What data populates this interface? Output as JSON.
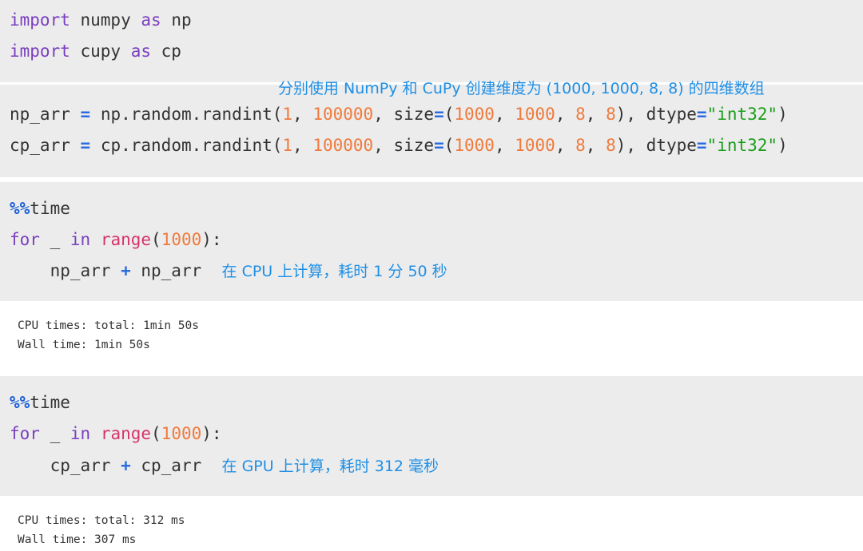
{
  "cells": [
    {
      "id": "imports",
      "lines": [
        {
          "kw1": "import",
          "mod": " numpy ",
          "kw2": "as",
          "alias": " np"
        },
        {
          "kw1": "import",
          "mod": " cupy ",
          "kw2": "as",
          "alias": " cp"
        }
      ]
    },
    {
      "id": "create-arrays",
      "annotation": "分别使用 NumPy 和 CuPy 创建维度为 (1000, 1000, 8, 8) 的四维数组",
      "lines": [
        {
          "var": "np_arr",
          "eq": "=",
          "call": " np.random.randint(",
          "a1": "1",
          "sep1": ", ",
          "a2": "100000",
          "sep2": ", size",
          "eq2": "=",
          "open": "(",
          "d1": "1000",
          "s1": ", ",
          "d2": "1000",
          "s2": ", ",
          "d3": "8",
          "s3": ", ",
          "d4": "8",
          "close": "), dtype",
          "eq3": "=",
          "dtype": "\"int32\"",
          "end": ")"
        },
        {
          "var": "cp_arr",
          "eq": "=",
          "call": " cp.random.randint(",
          "a1": "1",
          "sep1": ", ",
          "a2": "100000",
          "sep2": ", size",
          "eq2": "=",
          "open": "(",
          "d1": "1000",
          "s1": ", ",
          "d2": "1000",
          "s2": ", ",
          "d3": "8",
          "s3": ", ",
          "d4": "8",
          "close": "), dtype",
          "eq3": "=",
          "dtype": "\"int32\"",
          "end": ")"
        }
      ]
    },
    {
      "id": "numpy-timing",
      "magic": "%%",
      "magic_name": "time",
      "for_kw": "for",
      "loop_var": " _ ",
      "in_kw": "in",
      "range_fn": "range",
      "range_open": "(",
      "range_arg": "1000",
      "range_close": "):",
      "body_lhs": "    np_arr ",
      "body_op": "+",
      "body_rhs": " np_arr",
      "annotation": "在 CPU 上计算，耗时 1 分 50 秒",
      "output": [
        "CPU times: total: 1min 50s",
        "Wall time: 1min 50s"
      ]
    },
    {
      "id": "cupy-timing",
      "magic": "%%",
      "magic_name": "time",
      "for_kw": "for",
      "loop_var": " _ ",
      "in_kw": "in",
      "range_fn": "range",
      "range_open": "(",
      "range_arg": "1000",
      "range_close": "):",
      "body_lhs": "    cp_arr ",
      "body_op": "+",
      "body_rhs": " cp_arr",
      "annotation": "在 GPU 上计算，耗时 312 毫秒",
      "output": [
        "CPU times: total: 312 ms",
        "Wall time: 307 ms"
      ]
    }
  ]
}
